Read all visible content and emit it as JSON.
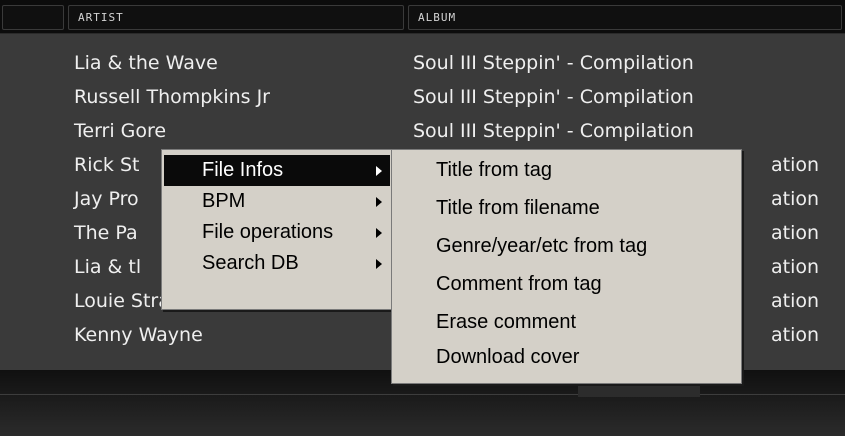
{
  "header": {
    "columns": {
      "artist": "ARTIST",
      "album": "ALBUM"
    }
  },
  "rows": [
    {
      "artist": "Lia & the Wave",
      "album": "Soul III Steppin' - Compilation"
    },
    {
      "artist": "Russell Thompkins Jr",
      "album": "Soul III Steppin' - Compilation"
    },
    {
      "artist": "Terri Gore",
      "album": "Soul III Steppin' - Compilation"
    },
    {
      "artist": "Rick St",
      "album": "ation"
    },
    {
      "artist": "Jay Pro",
      "album": "ation"
    },
    {
      "artist": "The Pa",
      "album": "ation"
    },
    {
      "artist": "Lia & tl",
      "album": "ation"
    },
    {
      "artist": "Louie Strann",
      "album": "ation"
    },
    {
      "artist": "Kenny Wayne",
      "album": "ation"
    }
  ],
  "context_menu": {
    "items": [
      "File Infos",
      "BPM",
      "File operations",
      "Search DB"
    ],
    "selected_index": 0
  },
  "submenu": {
    "items": [
      "Title from tag",
      "Title from filename",
      "Genre/year/etc from tag",
      "Comment from tag",
      "Erase comment",
      "Download cover"
    ]
  }
}
